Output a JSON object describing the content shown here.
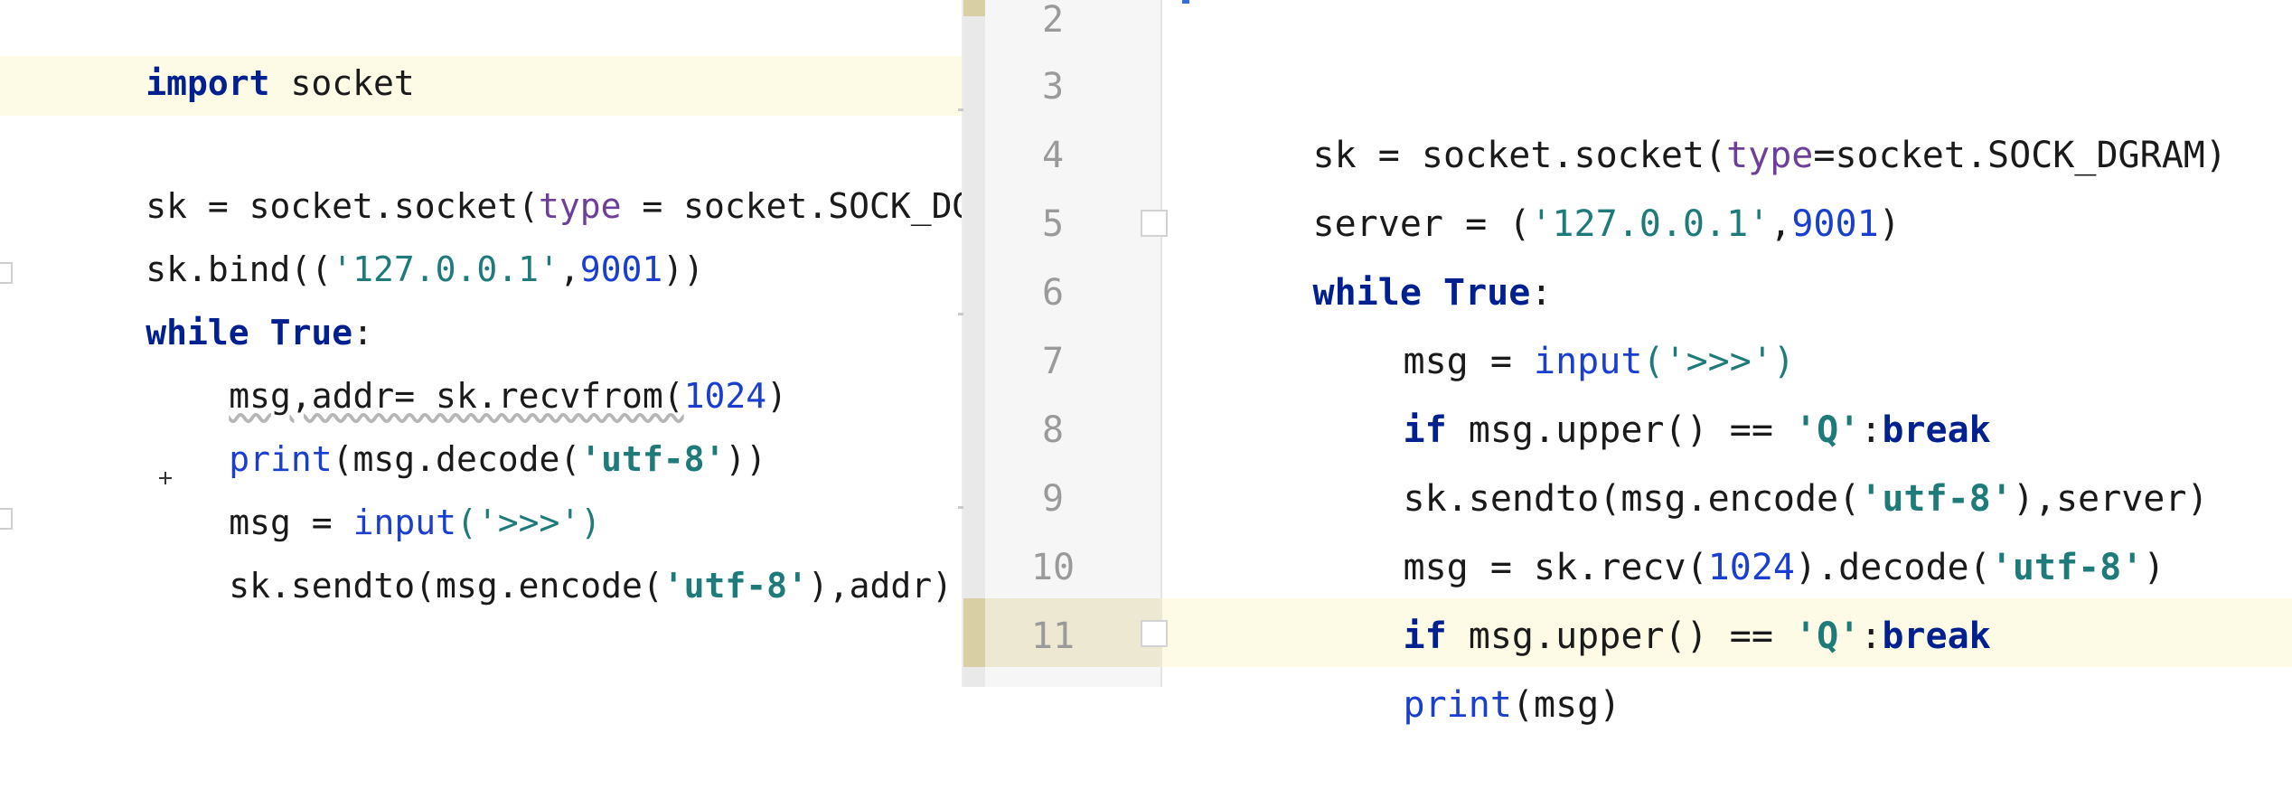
{
  "left_editor": {
    "lines": [
      {
        "segments": [
          {
            "t": "import",
            "c": "kw"
          },
          {
            "t": " socket",
            "c": "tx"
          }
        ]
      },
      {
        "segments": []
      },
      {
        "segments": [
          {
            "t": "sk = socket.socket(",
            "c": "tx"
          },
          {
            "t": "type",
            "c": "pm"
          },
          {
            "t": " = socket.SOCK_DGRAM)",
            "c": "tx"
          }
        ]
      },
      {
        "segments": [
          {
            "t": "sk.bind((",
            "c": "tx"
          },
          {
            "t": "'127.0.0.1'",
            "c": "st"
          },
          {
            "t": ",",
            "c": "tx"
          },
          {
            "t": "9001",
            "c": "nm"
          },
          {
            "t": "))",
            "c": "tx"
          }
        ]
      },
      {
        "segments": [
          {
            "t": "while",
            "c": "kw"
          },
          {
            "t": " ",
            "c": "tx"
          },
          {
            "t": "True",
            "c": "kw"
          },
          {
            "t": ":",
            "c": "tx"
          }
        ]
      },
      {
        "segments": [
          {
            "t": "msg,addr= sk.recvfrom(",
            "c": "tx"
          },
          {
            "t": "1024",
            "c": "nm"
          },
          {
            "t": ")",
            "c": "tx"
          }
        ]
      },
      {
        "segments": [
          {
            "t": "print",
            "c": "bi"
          },
          {
            "t": "(msg.decode(",
            "c": "tx"
          },
          {
            "t": "'utf-8'",
            "c": "sb"
          },
          {
            "t": "))",
            "c": "tx"
          }
        ]
      },
      {
        "segments": [
          {
            "t": "msg = ",
            "c": "tx"
          },
          {
            "t": "input",
            "c": "bi"
          },
          {
            "t": "('>>>')",
            "c": "st"
          }
        ]
      },
      {
        "segments": [
          {
            "t": "sk.sendto(msg.encode(",
            "c": "tx"
          },
          {
            "t": "'utf-8'",
            "c": "sb"
          },
          {
            "t": "),addr)",
            "c": "tx"
          }
        ]
      }
    ]
  },
  "right_editor": {
    "line_numbers": [
      "2",
      "3",
      "4",
      "5",
      "6",
      "7",
      "8",
      "9",
      "10",
      "11"
    ],
    "lines": [
      {
        "segments": []
      },
      {
        "segments": [
          {
            "t": "sk = socket.socket(",
            "c": "tx"
          },
          {
            "t": "type",
            "c": "pm"
          },
          {
            "t": "=socket.SOCK_DGRAM)",
            "c": "tx"
          }
        ]
      },
      {
        "segments": [
          {
            "t": "server = (",
            "c": "tx"
          },
          {
            "t": "'127.0.0.1'",
            "c": "st"
          },
          {
            "t": ",",
            "c": "tx"
          },
          {
            "t": "9001",
            "c": "nm"
          },
          {
            "t": ")",
            "c": "tx"
          }
        ]
      },
      {
        "segments": [
          {
            "t": "while",
            "c": "kw"
          },
          {
            "t": " ",
            "c": "tx"
          },
          {
            "t": "True",
            "c": "kw"
          },
          {
            "t": ":",
            "c": "tx"
          }
        ]
      },
      {
        "segments": [
          {
            "t": "msg = ",
            "c": "tx"
          },
          {
            "t": "input",
            "c": "bi"
          },
          {
            "t": "('>>>')",
            "c": "st"
          }
        ]
      },
      {
        "segments": [
          {
            "t": "if",
            "c": "kw"
          },
          {
            "t": " msg.upper() == ",
            "c": "tx"
          },
          {
            "t": "'Q'",
            "c": "sb"
          },
          {
            "t": ":",
            "c": "tx"
          },
          {
            "t": "break",
            "c": "kw"
          }
        ]
      },
      {
        "segments": [
          {
            "t": "sk.sendto(msg.encode(",
            "c": "tx"
          },
          {
            "t": "'utf-8'",
            "c": "sb"
          },
          {
            "t": "),server)",
            "c": "tx"
          }
        ]
      },
      {
        "segments": [
          {
            "t": "msg = sk.recv(",
            "c": "tx"
          },
          {
            "t": "1024",
            "c": "nm"
          },
          {
            "t": ").decode(",
            "c": "tx"
          },
          {
            "t": "'utf-8'",
            "c": "sb"
          },
          {
            "t": ")",
            "c": "tx"
          }
        ]
      },
      {
        "segments": [
          {
            "t": "if",
            "c": "kw"
          },
          {
            "t": " msg.upper() == ",
            "c": "tx"
          },
          {
            "t": "'Q'",
            "c": "sb"
          },
          {
            "t": ":",
            "c": "tx"
          },
          {
            "t": "break",
            "c": "kw"
          }
        ]
      },
      {
        "segments": [
          {
            "t": "print",
            "c": "bi"
          },
          {
            "t": "(msg)",
            "c": "tx"
          }
        ]
      }
    ]
  },
  "colors": {
    "keyword": "#00208f",
    "builtin": "#1a3fd0",
    "string": "#1f7a7a",
    "number": "#1a3fd0",
    "param": "#6e3f9a",
    "current_line": "#fdfbe6"
  }
}
